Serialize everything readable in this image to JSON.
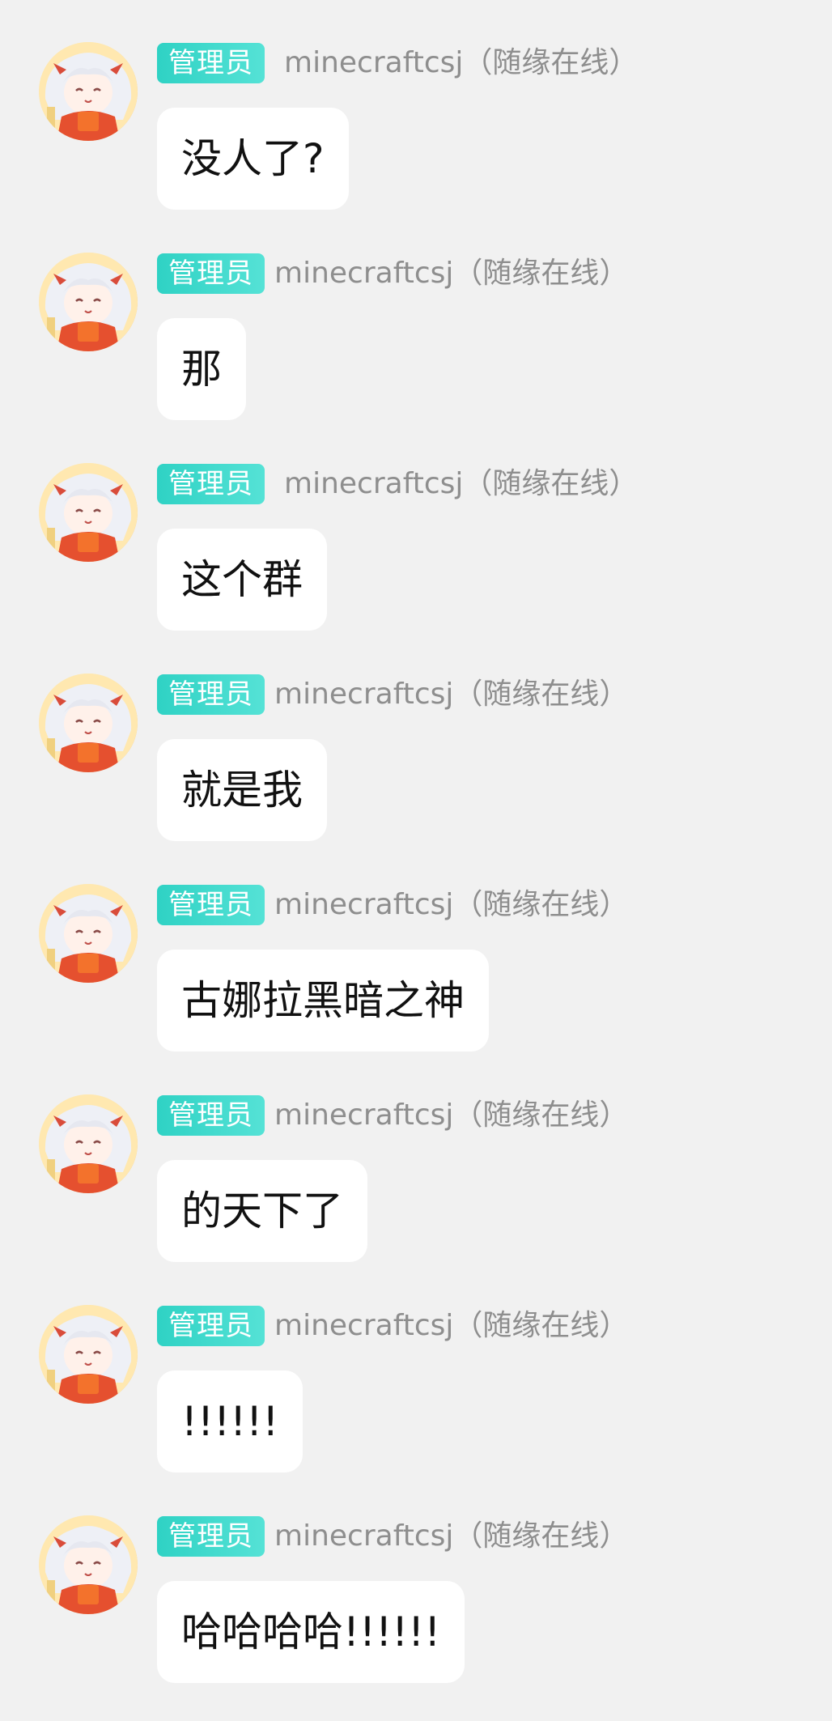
{
  "messages": [
    {
      "badge": "管理员",
      "sender": "minecraftcsj（随缘在线）",
      "text": "没人了?"
    },
    {
      "badge": "管理员",
      "sender": "minecraftcsj（随缘在线）",
      "text": "那"
    },
    {
      "badge": "管理员",
      "sender": "minecraftcsj（随缘在线）",
      "text": "这个群"
    },
    {
      "badge": "管理员",
      "sender": "minecraftcsj（随缘在线）",
      "text": "就是我"
    },
    {
      "badge": "管理员",
      "sender": "minecraftcsj（随缘在线）",
      "text": "古娜拉黑暗之神"
    },
    {
      "badge": "管理员",
      "sender": "minecraftcsj（随缘在线）",
      "text": "的天下了"
    },
    {
      "badge": "管理员",
      "sender": "minecraftcsj（随缘在线）",
      "text": "!!!!!!"
    },
    {
      "badge": "管理员",
      "sender": "minecraftcsj（随缘在线）",
      "text": "哈哈哈哈!!!!!!"
    }
  ],
  "colors": {
    "background": "#f1f1f1",
    "badge": "#2fd2c4",
    "sender": "#8e8e8e",
    "bubble": "#ffffff",
    "text": "#111111"
  },
  "icons": {
    "avatar": "anime-girl-avatar"
  }
}
